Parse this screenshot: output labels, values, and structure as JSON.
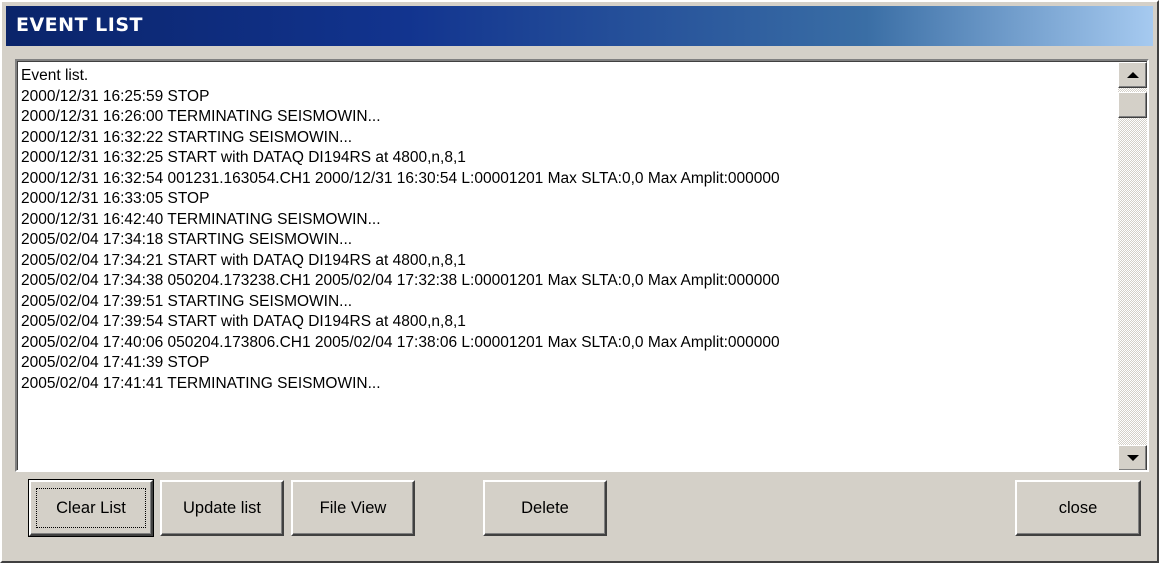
{
  "window": {
    "title": "EVENT LIST"
  },
  "event_list": {
    "lines": [
      "Event list.",
      "2000/12/31 16:25:59 STOP",
      "2000/12/31 16:26:00 TERMINATING SEISMOWIN...",
      "2000/12/31 16:32:22 STARTING SEISMOWIN...",
      "2000/12/31 16:32:25 START with DATAQ DI194RS at 4800,n,8,1",
      "2000/12/31 16:32:54 001231.163054.CH1 2000/12/31 16:30:54 L:00001201 Max SLTA:0,0 Max Amplit:000000",
      "2000/12/31 16:33:05 STOP",
      "2000/12/31 16:42:40 TERMINATING SEISMOWIN...",
      "2005/02/04 17:34:18 STARTING SEISMOWIN...",
      "2005/02/04 17:34:21 START with DATAQ DI194RS at 4800,n,8,1",
      "2005/02/04 17:34:38 050204.173238.CH1 2005/02/04 17:32:38 L:00001201 Max SLTA:0,0 Max Amplit:000000",
      "2005/02/04 17:39:51 STARTING SEISMOWIN...",
      "2005/02/04 17:39:54 START with DATAQ DI194RS at 4800,n,8,1",
      "2005/02/04 17:40:06 050204.173806.CH1 2005/02/04 17:38:06 L:00001201 Max SLTA:0,0 Max Amplit:000000",
      "2005/02/04 17:41:39 STOP",
      "2005/02/04 17:41:41 TERMINATING SEISMOWIN..."
    ]
  },
  "buttons": {
    "clear_list": "Clear List",
    "update_list": "Update list",
    "file_view": "File View",
    "delete": "Delete",
    "close": "close"
  },
  "icons": {
    "scroll_up": "arrow-up-icon",
    "scroll_down": "arrow-down-icon"
  },
  "colors": {
    "title_gradient_start": "#0a246a",
    "title_gradient_end": "#a6caf0",
    "face": "#d4d0c8"
  }
}
